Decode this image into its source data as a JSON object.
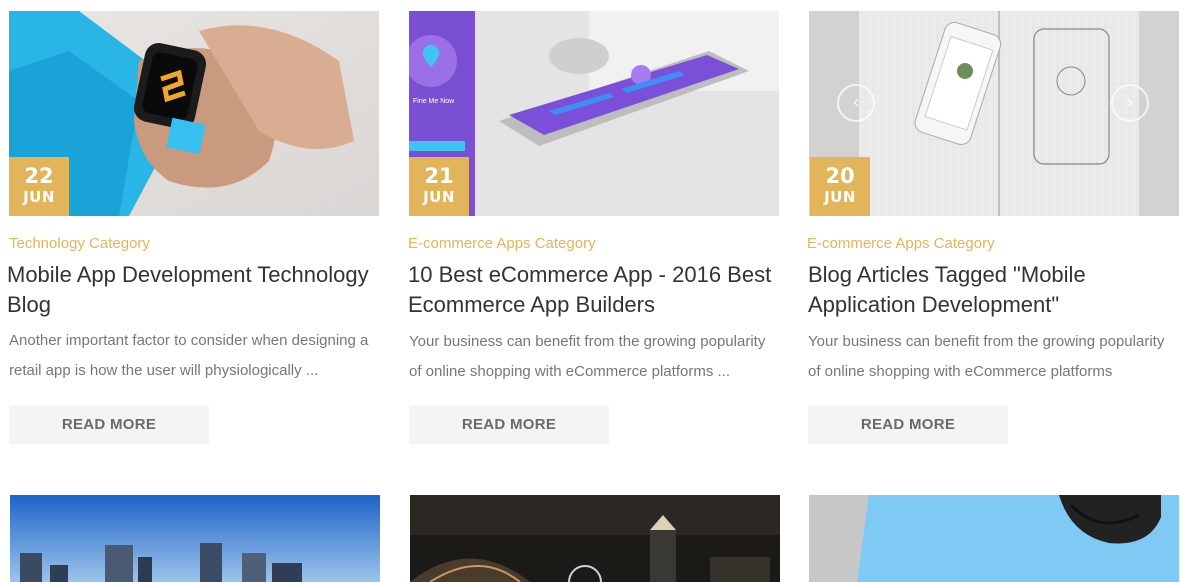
{
  "posts": [
    {
      "day": "22",
      "month": "JUN",
      "category": "Technology Category",
      "title": "Mobile App Development Technology Blog",
      "excerpt": "Another important factor to consider when designing a retail app is how the user will physiologically ...",
      "button": "READ MORE"
    },
    {
      "day": "21",
      "month": "JUN",
      "category": "E-commerce Apps Category",
      "title": "10 Best eCommerce App - 2016 Best Ecommerce App Builders",
      "excerpt": "Your business can benefit from the growing popularity of online shopping with eCommerce platforms ...",
      "button": "READ MORE",
      "image_text": {
        "app_label": "Fine Me Now"
      }
    },
    {
      "day": "20",
      "month": "JUN",
      "category": "E-commerce Apps Category",
      "title": "Blog Articles Tagged \"Mobile Application Development\"",
      "excerpt": "Your business can benefit from the growing popularity of online shopping with eCommerce platforms",
      "button": "READ MORE",
      "slider": {
        "prev": "‹",
        "next": "›"
      }
    }
  ],
  "colors": {
    "accent": "#e2b55a",
    "title": "#333333",
    "text": "#777777",
    "button_bg": "#f4f4f4"
  }
}
